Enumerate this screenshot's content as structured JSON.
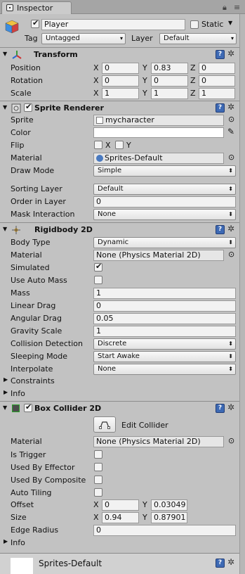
{
  "tab": {
    "label": "Inspector"
  },
  "gameobject": {
    "active": true,
    "name": "Player",
    "static_label": "Static",
    "tag_label": "Tag",
    "tag_value": "Untagged",
    "layer_label": "Layer",
    "layer_value": "Default"
  },
  "transform": {
    "title": "Transform",
    "rows": [
      {
        "label": "Position",
        "x": "0",
        "y": "0.83",
        "z": "0"
      },
      {
        "label": "Rotation",
        "x": "0",
        "y": "0",
        "z": "0"
      },
      {
        "label": "Scale",
        "x": "1",
        "y": "1",
        "z": "1"
      }
    ],
    "axis": {
      "x": "X",
      "y": "Y",
      "z": "Z"
    }
  },
  "sprite_renderer": {
    "title": "Sprite Renderer",
    "enabled": true,
    "sprite_label": "Sprite",
    "sprite_value": "mycharacter",
    "color_label": "Color",
    "color_value": "#ffffff",
    "flip_label": "Flip",
    "flip_x": "X",
    "flip_y": "Y",
    "material_label": "Material",
    "material_value": "Sprites-Default",
    "draw_mode_label": "Draw Mode",
    "draw_mode_value": "Simple",
    "sorting_layer_label": "Sorting Layer",
    "sorting_layer_value": "Default",
    "order_label": "Order in Layer",
    "order_value": "0",
    "mask_label": "Mask Interaction",
    "mask_value": "None"
  },
  "rigidbody": {
    "title": "Rigidbody 2D",
    "rows": [
      {
        "label": "Body Type",
        "kind": "drop",
        "value": "Dynamic"
      },
      {
        "label": "Material",
        "kind": "object",
        "value": "None (Physics Material 2D)"
      },
      {
        "label": "Simulated",
        "kind": "check",
        "checked": true
      },
      {
        "label": "Use Auto Mass",
        "kind": "check",
        "checked": false
      },
      {
        "label": "Mass",
        "kind": "field",
        "value": "1"
      },
      {
        "label": "Linear Drag",
        "kind": "field",
        "value": "0"
      },
      {
        "label": "Angular Drag",
        "kind": "field",
        "value": "0.05"
      },
      {
        "label": "Gravity Scale",
        "kind": "field",
        "value": "1"
      },
      {
        "label": "Collision Detection",
        "kind": "drop",
        "value": "Discrete"
      },
      {
        "label": "Sleeping Mode",
        "kind": "drop",
        "value": "Start Awake"
      },
      {
        "label": "Interpolate",
        "kind": "drop",
        "value": "None"
      }
    ],
    "constraints_label": "Constraints",
    "info_label": "Info"
  },
  "box_collider": {
    "title": "Box Collider 2D",
    "enabled": true,
    "edit_label": "Edit Collider",
    "material_label": "Material",
    "material_value": "None (Physics Material 2D)",
    "checks": [
      {
        "label": "Is Trigger",
        "checked": false
      },
      {
        "label": "Used By Effector",
        "checked": false
      },
      {
        "label": "Used By Composite",
        "checked": false
      },
      {
        "label": "Auto Tiling",
        "checked": false
      }
    ],
    "offset_label": "Offset",
    "offset_x": "0",
    "offset_y": "0.03049",
    "size_label": "Size",
    "size_x": "0.94",
    "size_y": "0.87901",
    "edge_label": "Edge Radius",
    "edge_value": "0",
    "info_label": "Info"
  },
  "preview": {
    "title": "Sprites-Default"
  },
  "colors": {
    "help_blue": "#3e6ab4",
    "panel_gray": "#c2c2c2"
  }
}
